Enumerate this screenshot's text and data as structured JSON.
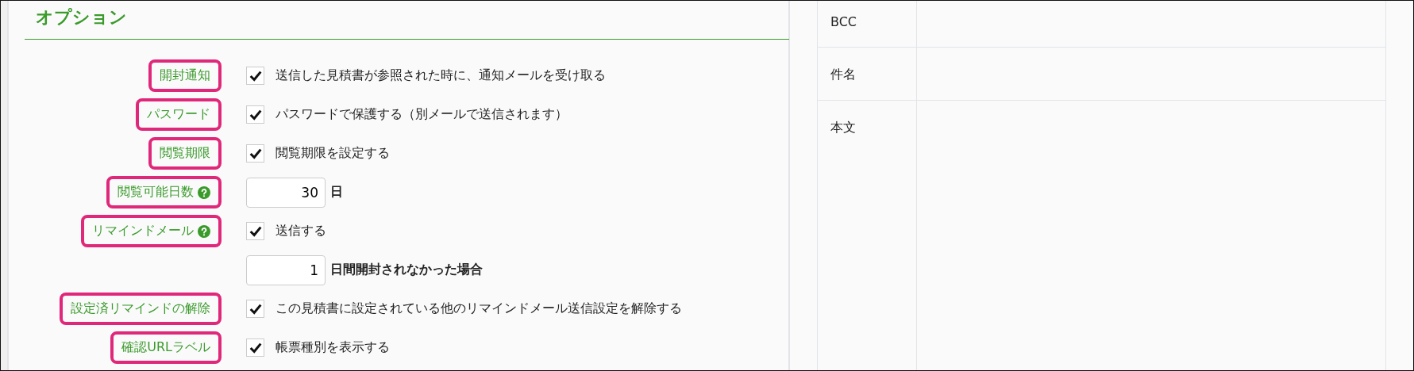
{
  "section_title": "オプション",
  "options": [
    {
      "label": "開封通知",
      "highlighted": true,
      "help": false,
      "kind": "checkbox",
      "checked": true,
      "text": "送信した見積書が参照された時に、通知メールを受け取る"
    },
    {
      "label": "パスワード",
      "highlighted": true,
      "help": false,
      "kind": "checkbox",
      "checked": true,
      "text": "パスワードで保護する（別メールで送信されます）"
    },
    {
      "label": "閲覧期限",
      "highlighted": true,
      "help": false,
      "kind": "checkbox",
      "checked": true,
      "text": "閲覧期限を設定する"
    },
    {
      "label": "閲覧可能日数",
      "highlighted": true,
      "help": true,
      "kind": "number",
      "value": "30",
      "text": "日"
    },
    {
      "label": "リマインドメール",
      "highlighted": true,
      "help": true,
      "kind": "checkbox",
      "checked": true,
      "text": "送信する"
    },
    {
      "kind": "number",
      "value": "1",
      "text": "日間開封されなかった場合"
    },
    {
      "label": "設定済リマインドの解除",
      "highlighted": true,
      "help": false,
      "kind": "checkbox",
      "checked": true,
      "text": "この見積書に設定されている他のリマインドメール送信設定を解除する"
    },
    {
      "label": "確認URLラベル",
      "highlighted": true,
      "help": false,
      "kind": "checkbox",
      "checked": true,
      "text": "帳票種別を表示する"
    }
  ],
  "mail_table": [
    {
      "label": "BCC"
    },
    {
      "label": "件名"
    },
    {
      "label": "本文"
    }
  ]
}
